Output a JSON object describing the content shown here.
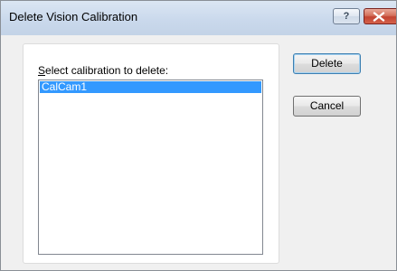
{
  "window": {
    "title": "Delete Vision Calibration",
    "help_glyph": "?",
    "close_icon": "close-x-icon",
    "close_button_color": "#c24331",
    "titlebar_color": "#cad9ec"
  },
  "form": {
    "list_label_mnemonic": "S",
    "list_label_rest": "elect calibration to delete:",
    "items": [
      {
        "label": "CalCam1",
        "selected": true
      }
    ],
    "selection_color": "#3399ff"
  },
  "buttons": {
    "delete_label": "Delete",
    "cancel_label": "Cancel"
  }
}
